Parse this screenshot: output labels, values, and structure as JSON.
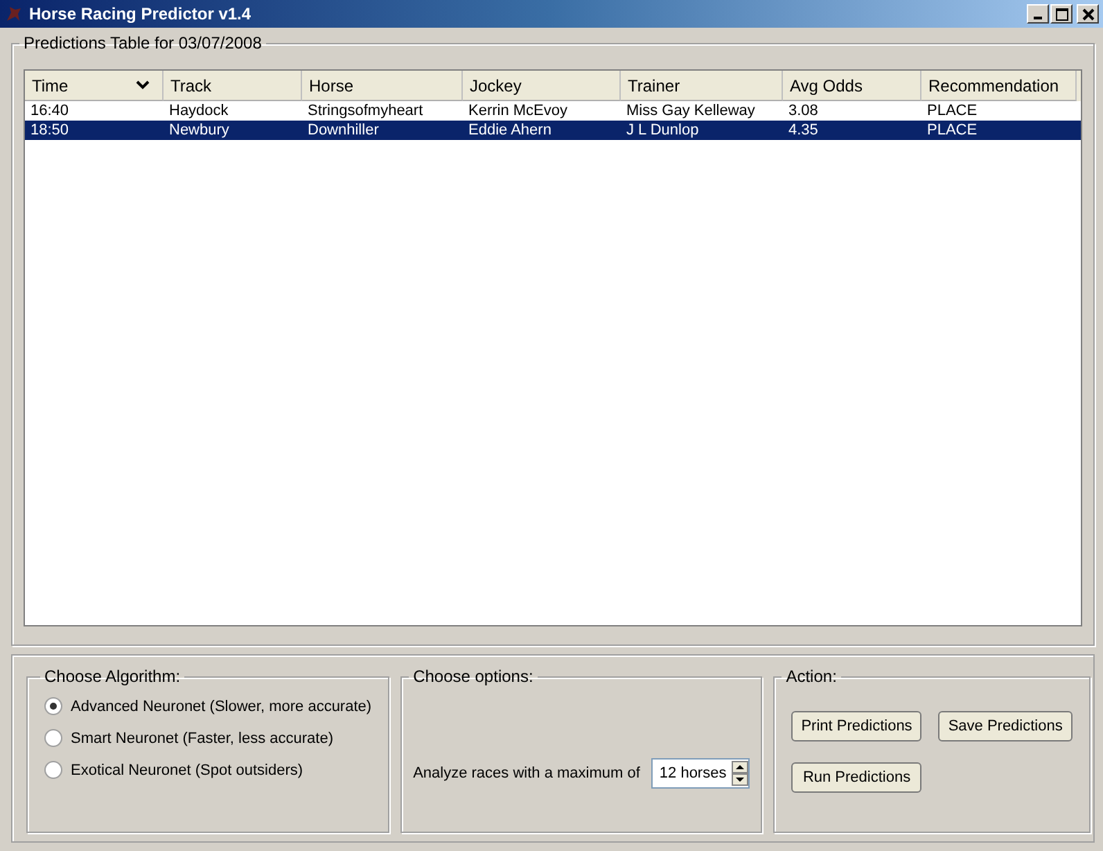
{
  "window": {
    "title": "Horse Racing Predictor v1.4"
  },
  "predictions": {
    "title": "Predictions Table for 03/07/2008",
    "columns": [
      {
        "label": "Time",
        "sorted": true
      },
      {
        "label": "Track",
        "sorted": false
      },
      {
        "label": "Horse",
        "sorted": false
      },
      {
        "label": "Jockey",
        "sorted": false
      },
      {
        "label": "Trainer",
        "sorted": false
      },
      {
        "label": "Avg Odds",
        "sorted": false
      },
      {
        "label": "Recommendation",
        "sorted": false
      }
    ],
    "rows": [
      {
        "selected": false,
        "cells": [
          "16:40",
          "Haydock",
          "Stringsofmyheart",
          "Kerrin McEvoy",
          "Miss Gay Kelleway",
          "3.08",
          "PLACE"
        ]
      },
      {
        "selected": true,
        "cells": [
          "18:50",
          "Newbury",
          "Downhiller",
          "Eddie Ahern",
          "J L Dunlop",
          "4.35",
          "PLACE"
        ]
      }
    ]
  },
  "algorithm": {
    "title": "Choose Algorithm:",
    "options": [
      {
        "label": "Advanced Neuronet (Slower, more accurate)",
        "selected": true
      },
      {
        "label": "Smart Neuronet (Faster, less accurate)",
        "selected": false
      },
      {
        "label": "Exotical Neuronet (Spot outsiders)",
        "selected": false
      }
    ]
  },
  "options": {
    "title": "Choose options:",
    "label": "Analyze races with a maximum of",
    "value": "12 horses"
  },
  "action": {
    "title": "Action:",
    "buttons": [
      "Print Predictions",
      "Save Predictions",
      "Run Predictions"
    ]
  }
}
